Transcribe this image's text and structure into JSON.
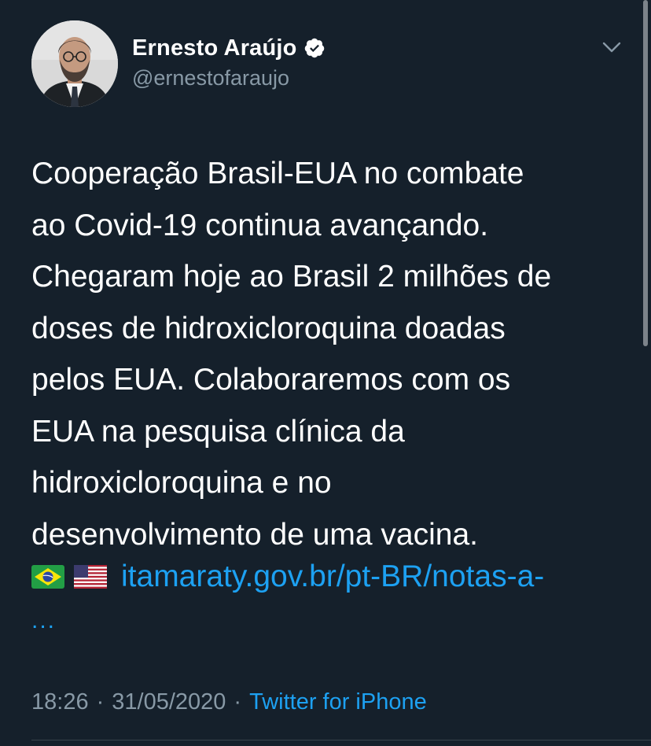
{
  "user": {
    "display_name": "Ernesto Araújo",
    "handle": "@ernestofaraujo",
    "verified": true
  },
  "tweet": {
    "text": "Cooperação Brasil-EUA no combate\nao Covid-19 continua avançando.\nChegaram hoje ao Brasil 2 milhões de\ndoses de hidroxicloroquina doadas\npelos EUA. Colaboraremos com os\nEUA na pesquisa clínica da\nhidroxicloroquina e no\ndesenvolvimento de uma vacina.",
    "flags": [
      "brazil-flag-icon",
      "us-flag-icon"
    ],
    "link": "itamaraty.gov.br/pt-BR/notas-a-",
    "link_ellipsis": "...",
    "time": "18:26",
    "date": "31/05/2020",
    "separator": "·",
    "source": "Twitter for iPhone"
  },
  "colors": {
    "background": "#15202b",
    "text": "#ffffff",
    "secondary": "#8899a6",
    "accent": "#1da1f2",
    "divider": "#38444d"
  }
}
